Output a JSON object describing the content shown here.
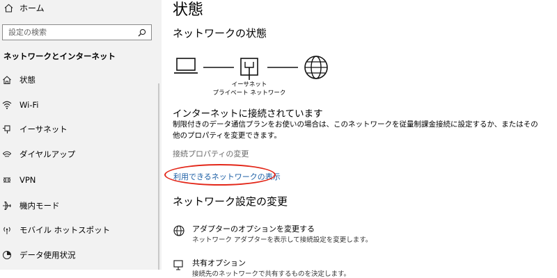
{
  "sidebar": {
    "home_label": "ホーム",
    "search_placeholder": "設定の検索",
    "section_title": "ネットワークとインターネット",
    "items": [
      {
        "label": "状態",
        "icon": "home-status-icon"
      },
      {
        "label": "Wi-Fi",
        "icon": "wifi-icon"
      },
      {
        "label": "イーサネット",
        "icon": "ethernet-icon"
      },
      {
        "label": "ダイヤルアップ",
        "icon": "dialup-icon"
      },
      {
        "label": "VPN",
        "icon": "vpn-icon"
      },
      {
        "label": "機内モード",
        "icon": "airplane-icon"
      },
      {
        "label": "モバイル ホットスポット",
        "icon": "hotspot-icon"
      },
      {
        "label": "データ使用状況",
        "icon": "data-usage-icon"
      }
    ]
  },
  "main": {
    "title": "状態",
    "network_status_heading": "ネットワークの状態",
    "diagram": {
      "device_line1": "イーサネット",
      "device_line2": "プライベート ネットワーク"
    },
    "status_text": "インターネットに接続されています",
    "description": "制限付きのデータ通信プランをお使いの場合は、このネットワークを従量制課金接続に設定するか、またはその他のプロパティを変更できます。",
    "change_properties_link": "接続プロパティの変更",
    "show_networks_link": "利用できるネットワークの表示",
    "settings_heading": "ネットワーク設定の変更",
    "options": [
      {
        "title": "アダプターのオプションを変更する",
        "description": "ネットワーク アダプターを表示して接続設定を変更します。"
      },
      {
        "title": "共有オプション",
        "description": "接続先のネットワークで共有するものを決定します。"
      }
    ]
  },
  "colors": {
    "highlight_oval": "#e32618",
    "link": "#1d5fa5",
    "sidebar_bg": "#f2f2f2"
  }
}
